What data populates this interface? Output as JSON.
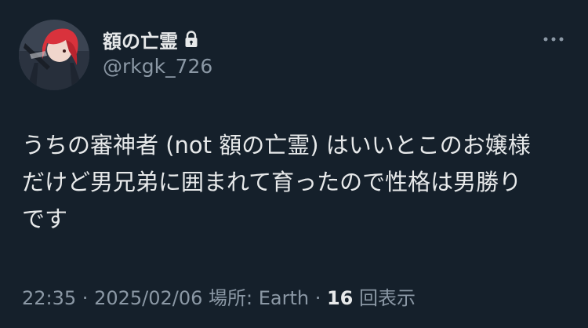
{
  "author": {
    "display_name": "額の亡霊",
    "handle": "@rkgk_726",
    "protected_icon": "lock-icon",
    "avatar_icon": "avatar-image"
  },
  "more_icon": "more-horizontal-icon",
  "post": {
    "text": "うちの審神者 (not 額の亡霊) はいいとこのお嬢様\nだけど男兄弟に囲まれて育ったので性格は男勝り\nです"
  },
  "meta": {
    "time": "22:35",
    "sep1": " · ",
    "date": "2025/02/06",
    "location_label": " 場所: Earth",
    "sep2": " · ",
    "views_count": "16",
    "views_label": " 回表示"
  },
  "colors": {
    "background": "#15202b",
    "text_primary": "#e7e9ea",
    "text_secondary": "#8b98a5"
  }
}
